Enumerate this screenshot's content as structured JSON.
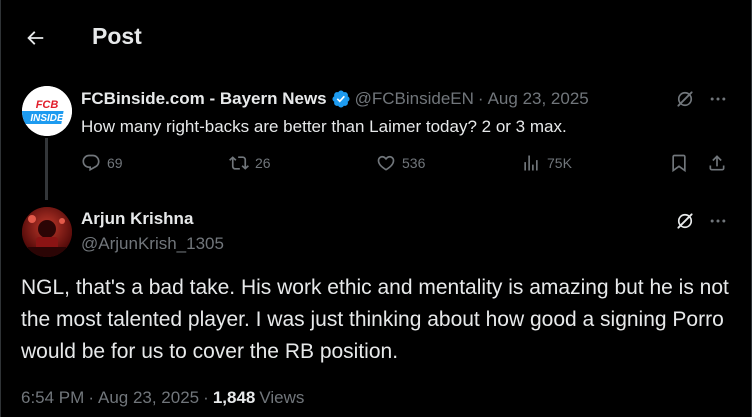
{
  "header": {
    "title": "Post"
  },
  "post1": {
    "author_name": "FCBinside.com - Bayern News",
    "handle": "@FCBinsideEN",
    "date": "Aug 23, 2025",
    "text": "How many right-backs are better than Laimer today? 2 or 3 max.",
    "avatar_logo_top": "FCB",
    "avatar_logo_bottom": "INSIDE",
    "replies": "69",
    "reposts": "26",
    "likes": "536",
    "views": "75K",
    "brand_color": "#e11d2a",
    "verified_color": "#1d9bf0"
  },
  "post2": {
    "author_name": "Arjun Krishna",
    "handle": "@ArjunKrish_1305",
    "text": "NGL, that's a bad take. His work ethic and mentality is amazing but he is not the most talented player. I was just thinking about how good a signing Porro would be for us to cover the RB position.",
    "time": "6:54 PM",
    "date": "Aug 23, 2025",
    "views_count": "1,848",
    "views_label": "Views"
  },
  "separator": "·"
}
